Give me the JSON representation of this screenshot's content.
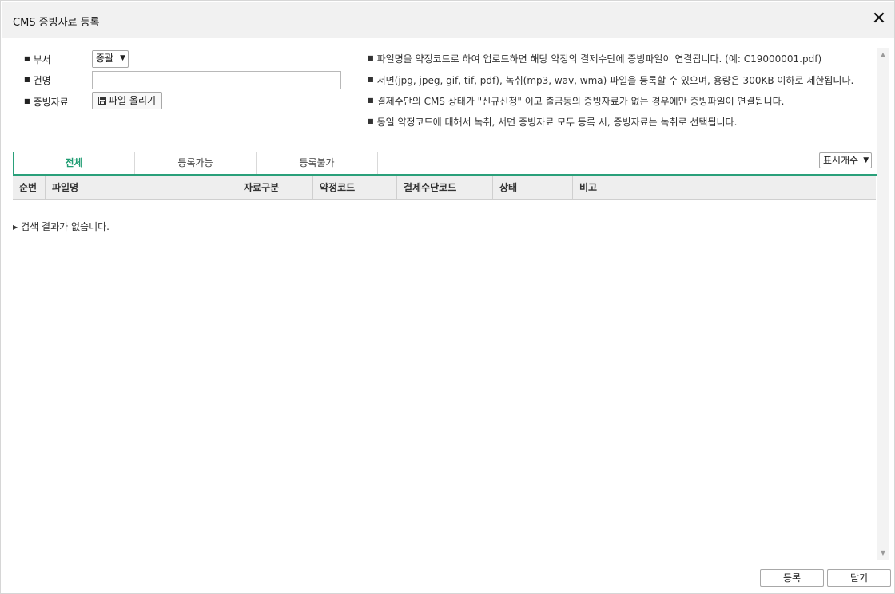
{
  "window": {
    "title": "CMS 증빙자료 등록",
    "close_label": "✕"
  },
  "form": {
    "dept_label": "부서",
    "dept_value": "종괄",
    "name_label": "건명",
    "name_value": "",
    "evidence_label": "증빙자료",
    "upload_label": "파일 올리기"
  },
  "notes": [
    "파일명을 약정코드로 하여 업로드하면 해당 약정의 결제수단에 증빙파일이 연결됩니다. (예: C19000001.pdf)",
    "서면(jpg, jpeg, gif, tif, pdf), 녹취(mp3, wav, wma) 파일을 등록할 수 있으며, 용량은 300KB 이하로 제한됩니다.",
    "결제수단의 CMS 상태가 \"신규신청\" 이고 출금동의 증빙자료가 없는 경우에만 증빙파일이 연결됩니다.",
    "동일 약정코드에 대해서 녹취, 서면 증빙자료 모두 등록 시, 증빙자료는 녹취로 선택됩니다."
  ],
  "tabs": [
    "전체",
    "등록가능",
    "등록불가"
  ],
  "page_size_label": "표시개수",
  "table": {
    "columns": [
      "순번",
      "파일명",
      "자료구분",
      "약정코드",
      "결제수단코드",
      "상태",
      "비고"
    ],
    "empty_message": "검색 결과가 없습니다."
  },
  "footer": {
    "register_label": "등록",
    "close_label": "닫기"
  },
  "colors": {
    "accent": "#2aa07a",
    "header_bg": "#f1f1f1",
    "table_header_bg": "#eeeeee"
  }
}
